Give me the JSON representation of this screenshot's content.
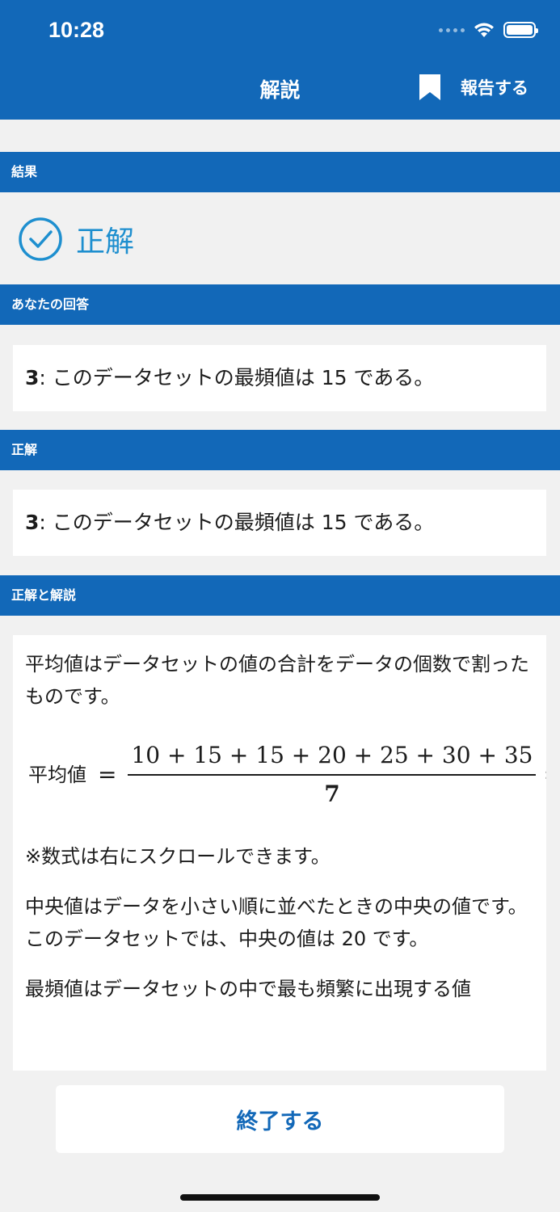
{
  "status_bar": {
    "time": "10:28"
  },
  "nav": {
    "title": "解説",
    "report_label": "報告する"
  },
  "sections": {
    "result_header": "結果",
    "result_text": "正解",
    "your_answer_header": "あなたの回答",
    "your_answer_number": "3",
    "your_answer_text": ": このデータセットの最頻値は 15 である。",
    "correct_header": "正解",
    "correct_number": "3",
    "correct_text": ": このデータセットの最頻値は 15 である。",
    "explanation_header": "正解と解説"
  },
  "explanation": {
    "para1": "平均値はデータセットの値の合計をデータの個数で割ったものです。",
    "formula_lhs": "平均値",
    "formula_eq": "=",
    "formula_numerator": "10 + 15 + 15 + 20 + 25 + 30 + 35",
    "formula_denominator": "7",
    "formula_tail": ":",
    "scroll_note": "※数式は右にスクロールできます。",
    "para2": "中央値はデータを小さい順に並べたときの中央の値です。このデータセットでは、中央の値は 20 です。",
    "para3": "最頻値はデータセットの中で最も頻繁に出現する値"
  },
  "footer": {
    "finish_label": "終了する"
  },
  "colors": {
    "primary": "#1268b8",
    "success": "#1e8fcf",
    "background": "#f1f1f1"
  },
  "icons": {
    "signal": "cellular-signal-icon",
    "wifi": "wifi-icon",
    "battery": "battery-icon",
    "bookmark": "bookmark-icon",
    "check": "check-circle-icon"
  }
}
